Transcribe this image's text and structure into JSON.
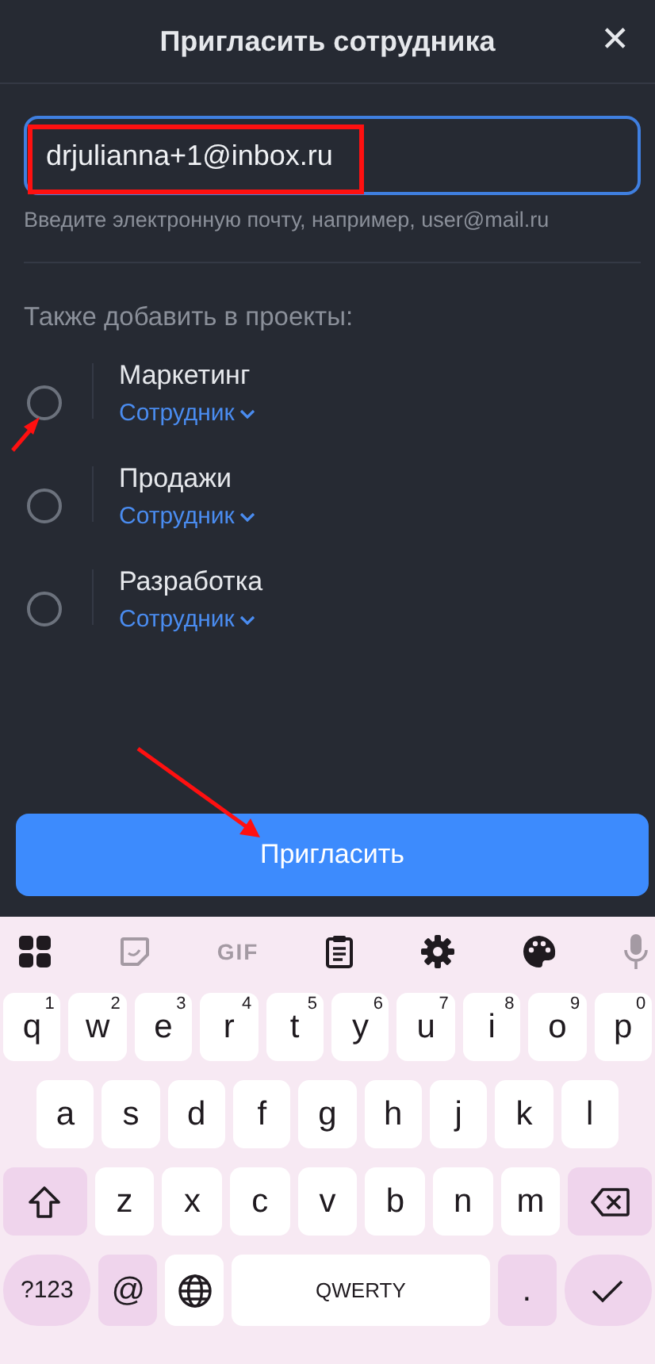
{
  "header": {
    "title": "Пригласить сотрудника",
    "close": "✕"
  },
  "email": {
    "value": "drjulianna+1@inbox.ru",
    "hint": "Введите электронную почту, например, user@mail.ru"
  },
  "projects_label": "Также добавить в проекты:",
  "projects": [
    {
      "name": "Маркетинг",
      "role": "Сотрудник",
      "selected": false
    },
    {
      "name": "Продажи",
      "role": "Сотрудник",
      "selected": false
    },
    {
      "name": "Разработка",
      "role": "Сотрудник",
      "selected": false
    }
  ],
  "invite_button": "Пригласить",
  "keyboard": {
    "gif": "GIF",
    "rows": [
      {
        "keys": [
          {
            "kind": "letter",
            "label": "q",
            "hint": "1"
          },
          {
            "kind": "letter",
            "label": "w",
            "hint": "2"
          },
          {
            "kind": "letter",
            "label": "e",
            "hint": "3"
          },
          {
            "kind": "letter",
            "label": "r",
            "hint": "4"
          },
          {
            "kind": "letter",
            "label": "t",
            "hint": "5"
          },
          {
            "kind": "letter",
            "label": "y",
            "hint": "6"
          },
          {
            "kind": "letter",
            "label": "u",
            "hint": "7"
          },
          {
            "kind": "letter",
            "label": "i",
            "hint": "8"
          },
          {
            "kind": "letter",
            "label": "o",
            "hint": "9"
          },
          {
            "kind": "letter",
            "label": "p",
            "hint": "0"
          }
        ]
      },
      {
        "keys": [
          {
            "kind": "letter",
            "label": "a"
          },
          {
            "kind": "letter",
            "label": "s"
          },
          {
            "kind": "letter",
            "label": "d"
          },
          {
            "kind": "letter",
            "label": "f"
          },
          {
            "kind": "letter",
            "label": "g"
          },
          {
            "kind": "letter",
            "label": "h"
          },
          {
            "kind": "letter",
            "label": "j"
          },
          {
            "kind": "letter",
            "label": "k"
          },
          {
            "kind": "letter",
            "label": "l"
          }
        ]
      },
      {
        "keys": [
          {
            "kind": "shift"
          },
          {
            "kind": "letter",
            "label": "z"
          },
          {
            "kind": "letter",
            "label": "x"
          },
          {
            "kind": "letter",
            "label": "c"
          },
          {
            "kind": "letter",
            "label": "v"
          },
          {
            "kind": "letter",
            "label": "b"
          },
          {
            "kind": "letter",
            "label": "n"
          },
          {
            "kind": "letter",
            "label": "m"
          },
          {
            "kind": "backspace"
          }
        ]
      },
      {
        "keys": [
          {
            "kind": "symbols",
            "label": "?123"
          },
          {
            "kind": "char",
            "label": "@"
          },
          {
            "kind": "globe"
          },
          {
            "kind": "space",
            "label": "QWERTY"
          },
          {
            "kind": "char",
            "label": "."
          },
          {
            "kind": "enter"
          }
        ]
      }
    ]
  }
}
